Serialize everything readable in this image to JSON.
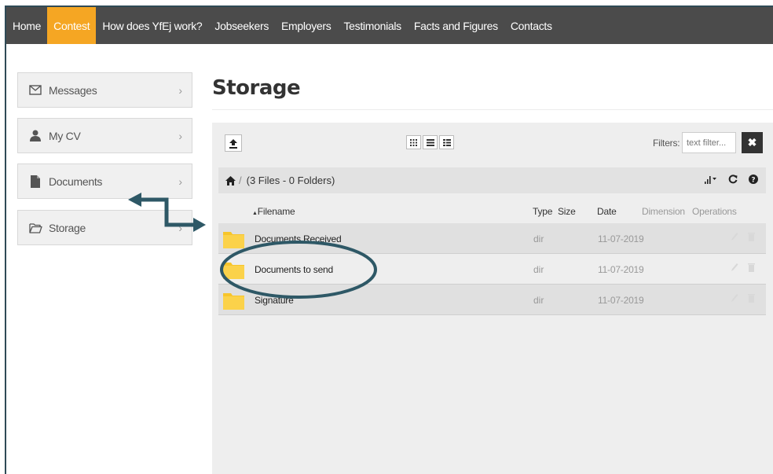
{
  "nav": {
    "items": [
      {
        "label": "Home",
        "active": false
      },
      {
        "label": "Contest",
        "active": true
      },
      {
        "label": "How does YfEj work?",
        "active": false
      },
      {
        "label": "Jobseekers",
        "active": false
      },
      {
        "label": "Employers",
        "active": false
      },
      {
        "label": "Testimonials",
        "active": false
      },
      {
        "label": "Facts and Figures",
        "active": false
      },
      {
        "label": "Contacts",
        "active": false
      }
    ],
    "accent_color": "#f5a623",
    "bar_color": "#4b4b4b"
  },
  "sidebar": {
    "items": [
      {
        "label": "Messages",
        "icon": "envelope-icon"
      },
      {
        "label": "My CV",
        "icon": "user-icon"
      },
      {
        "label": "Documents",
        "icon": "document-icon"
      },
      {
        "label": "Storage",
        "icon": "folder-open-icon"
      }
    ]
  },
  "page": {
    "title": "Storage"
  },
  "file_manager": {
    "filters_label": "Filters:",
    "filter_placeholder": "text filter...",
    "breadcrumb_text": "(3 Files - 0 Folders)",
    "columns": {
      "filename": "Filename",
      "type": "Type",
      "size": "Size",
      "date": "Date",
      "dimension": "Dimension",
      "operations": "Operations"
    },
    "rows": [
      {
        "name": "Documents Received",
        "type": "dir",
        "date": "11-07-2019"
      },
      {
        "name": "Documents to send",
        "type": "dir",
        "date": "11-07-2019"
      },
      {
        "name": "Signature",
        "type": "dir",
        "date": "11-07-2019"
      }
    ],
    "folder_color": "#f7c52b"
  },
  "annotations": {
    "color": "#2e5866"
  }
}
